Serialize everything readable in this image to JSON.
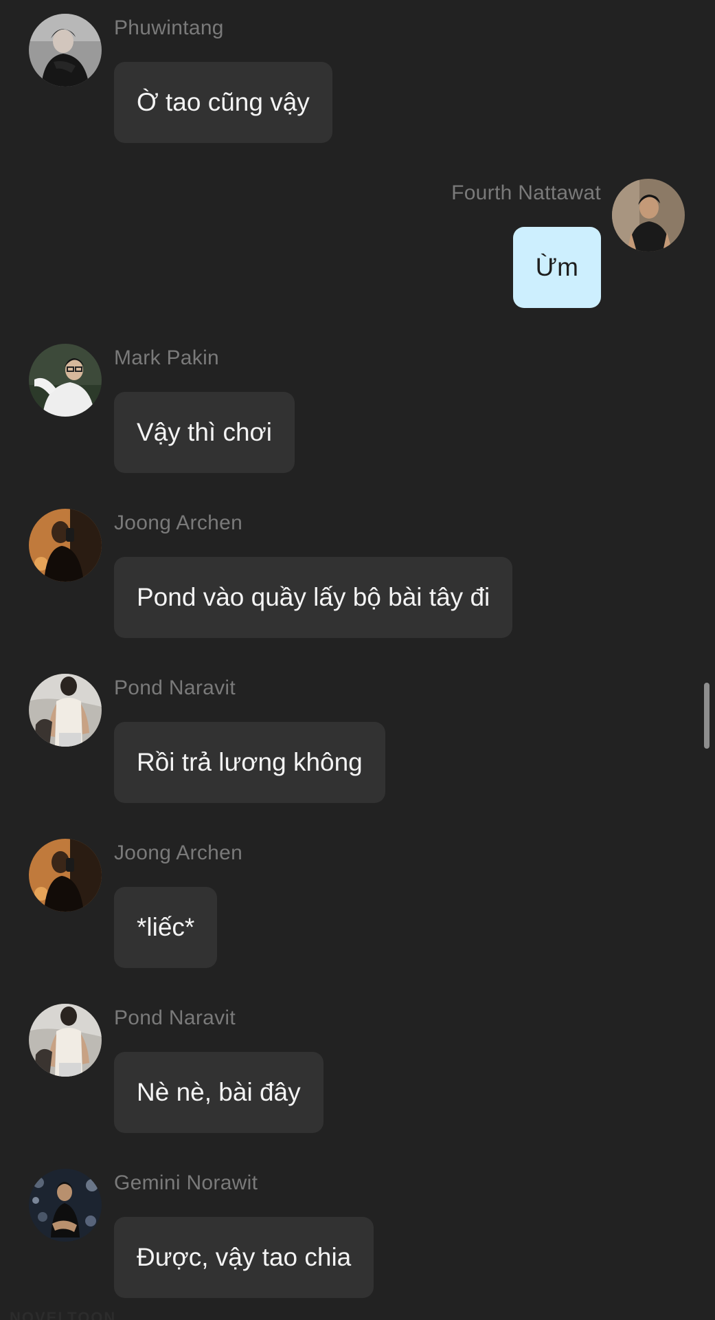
{
  "messages": [
    {
      "sender": "Phuwintang",
      "text": "Ờ tao cũng vậy",
      "side": "left",
      "avatar": "avatar-phuwintang"
    },
    {
      "sender": "Fourth Nattawat",
      "text": "Ừm",
      "side": "right",
      "avatar": "avatar-fourth-nattawat"
    },
    {
      "sender": "Mark Pakin",
      "text": "Vậy thì chơi",
      "side": "left",
      "avatar": "avatar-mark-pakin"
    },
    {
      "sender": "Joong Archen",
      "text": "Pond vào quầy lấy bộ bài tây đi",
      "side": "left",
      "avatar": "avatar-joong-archen"
    },
    {
      "sender": "Pond Naravit",
      "text": "Rồi trả lương không",
      "side": "left",
      "avatar": "avatar-pond-naravit"
    },
    {
      "sender": "Joong Archen",
      "text": "*liếc*",
      "side": "left",
      "avatar": "avatar-joong-archen"
    },
    {
      "sender": "Pond Naravit",
      "text": "Nè nè, bài đây",
      "side": "left",
      "avatar": "avatar-pond-naravit"
    },
    {
      "sender": "Gemini Norawit",
      "text": "Được, vậy tao chia",
      "side": "left",
      "avatar": "avatar-gemini-norawit"
    }
  ],
  "watermark": "NOVELTOON",
  "colors": {
    "background": "#222222",
    "incoming_bubble": "#323232",
    "outgoing_bubble": "#cdeffe",
    "sender_name": "#7a7a7a",
    "incoming_text": "#f4f4f4",
    "outgoing_text": "#1e1e1e"
  }
}
